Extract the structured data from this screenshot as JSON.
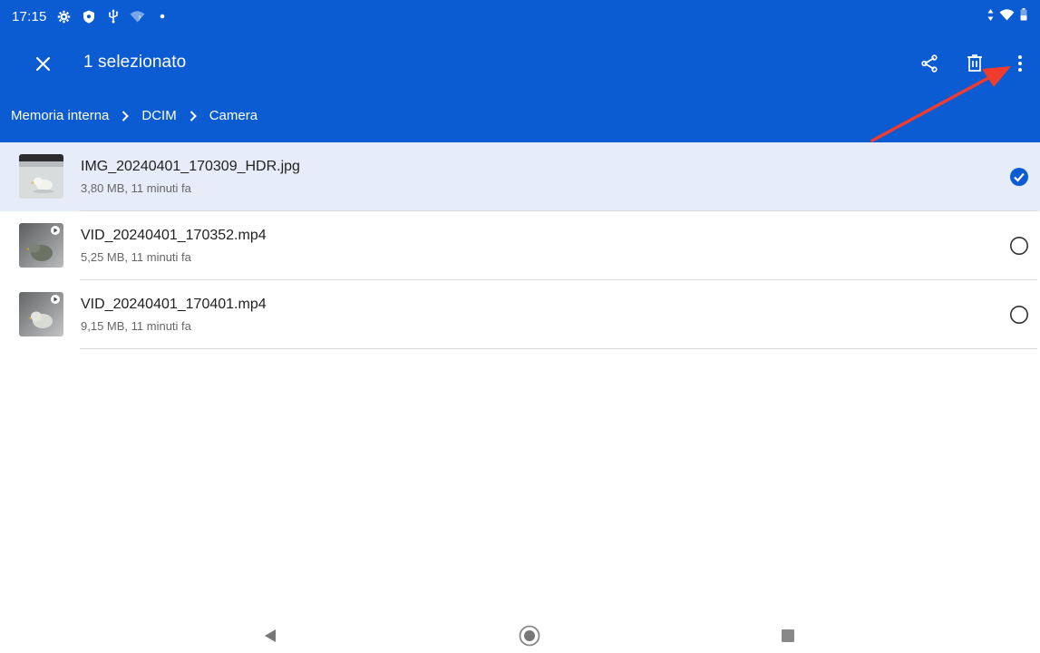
{
  "status_bar": {
    "time": "17:15",
    "icons": [
      "settings-icon",
      "shield-icon",
      "usb-icon",
      "wifi-question-icon",
      "dot-icon"
    ],
    "right_icons": [
      "data-arrows-icon",
      "wifi-icon",
      "battery-icon"
    ]
  },
  "app_bar": {
    "title": "1 selezionato",
    "close_icon": "close-icon",
    "actions": [
      "share-icon",
      "delete-icon",
      "more-vert-icon"
    ]
  },
  "breadcrumb": {
    "items": [
      "Memoria interna",
      "DCIM",
      "Camera"
    ],
    "separator_icon": "chevron-right-icon"
  },
  "files": [
    {
      "name": "IMG_20240401_170309_HDR.jpg",
      "meta": "3,80 MB, 11 minuti fa",
      "type": "image",
      "selected": true
    },
    {
      "name": "VID_20240401_170352.mp4",
      "meta": "5,25 MB, 11 minuti fa",
      "type": "video",
      "selected": false
    },
    {
      "name": "VID_20240401_170401.mp4",
      "meta": "9,15 MB, 11 minuti fa",
      "type": "video",
      "selected": false
    }
  ],
  "nav_bar": {
    "buttons": [
      "back-icon",
      "home-icon",
      "recents-icon"
    ]
  },
  "colors": {
    "header": "#0b5bd3",
    "selected_row": "#e6ecf8",
    "check_selected": "#0b5bd3",
    "annotation_arrow": "#f03c2e"
  }
}
